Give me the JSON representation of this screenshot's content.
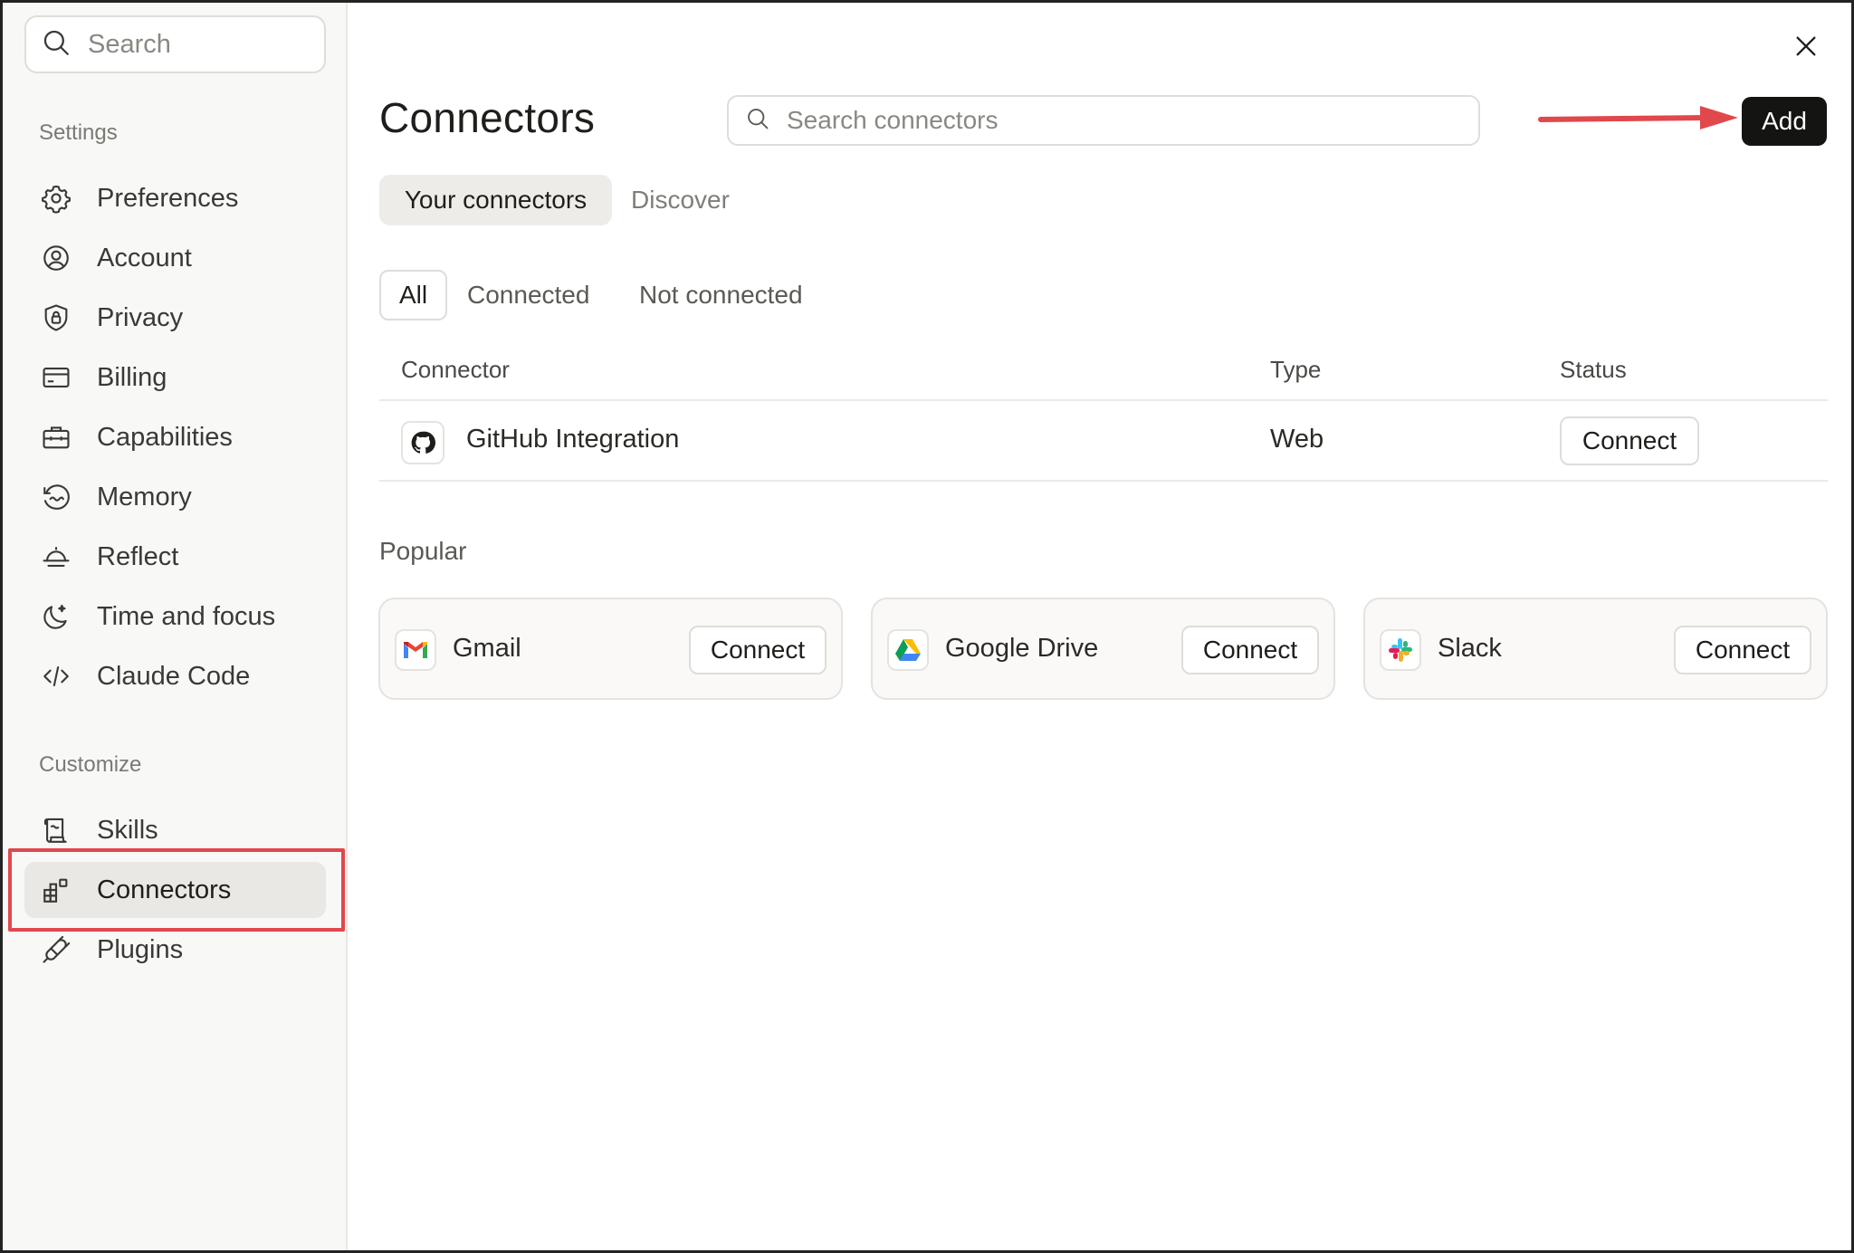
{
  "sidebar": {
    "search_placeholder": "Search",
    "settings_heading": "Settings",
    "settings_items": [
      {
        "label": "Preferences",
        "icon": "gear-icon"
      },
      {
        "label": "Account",
        "icon": "user-circle-icon"
      },
      {
        "label": "Privacy",
        "icon": "shield-lock-icon"
      },
      {
        "label": "Billing",
        "icon": "credit-card-icon"
      },
      {
        "label": "Capabilities",
        "icon": "briefcase-icon"
      },
      {
        "label": "Memory",
        "icon": "memory-icon"
      },
      {
        "label": "Reflect",
        "icon": "sunrise-icon"
      },
      {
        "label": "Time and focus",
        "icon": "moon-icon"
      },
      {
        "label": "Claude Code",
        "icon": "code-icon"
      }
    ],
    "customize_heading": "Customize",
    "customize_items": [
      {
        "label": "Skills",
        "icon": "scroll-icon"
      },
      {
        "label": "Connectors",
        "icon": "connectors-icon",
        "active": true
      },
      {
        "label": "Plugins",
        "icon": "plug-icon"
      }
    ]
  },
  "main": {
    "title": "Connectors",
    "search_placeholder": "Search connectors",
    "add_label": "Add",
    "tabs": [
      {
        "label": "Your connectors",
        "active": true
      },
      {
        "label": "Discover",
        "active": false
      }
    ],
    "filters": [
      {
        "label": "All",
        "active": true
      },
      {
        "label": "Connected",
        "active": false
      },
      {
        "label": "Not connected",
        "active": false
      }
    ],
    "table": {
      "headers": [
        "Connector",
        "Type",
        "Status"
      ],
      "rows": [
        {
          "name": "GitHub Integration",
          "type": "Web",
          "action": "Connect",
          "icon": "github-icon"
        }
      ]
    },
    "popular_heading": "Popular",
    "popular": [
      {
        "name": "Gmail",
        "action": "Connect",
        "icon": "gmail-icon"
      },
      {
        "name": "Google Drive",
        "action": "Connect",
        "icon": "google-drive-icon"
      },
      {
        "name": "Slack",
        "action": "Connect",
        "icon": "slack-icon"
      }
    ]
  },
  "colors": {
    "highlight": "#e0484c",
    "add_button": "#141413",
    "sidebar_bg": "#f8f8f6"
  }
}
